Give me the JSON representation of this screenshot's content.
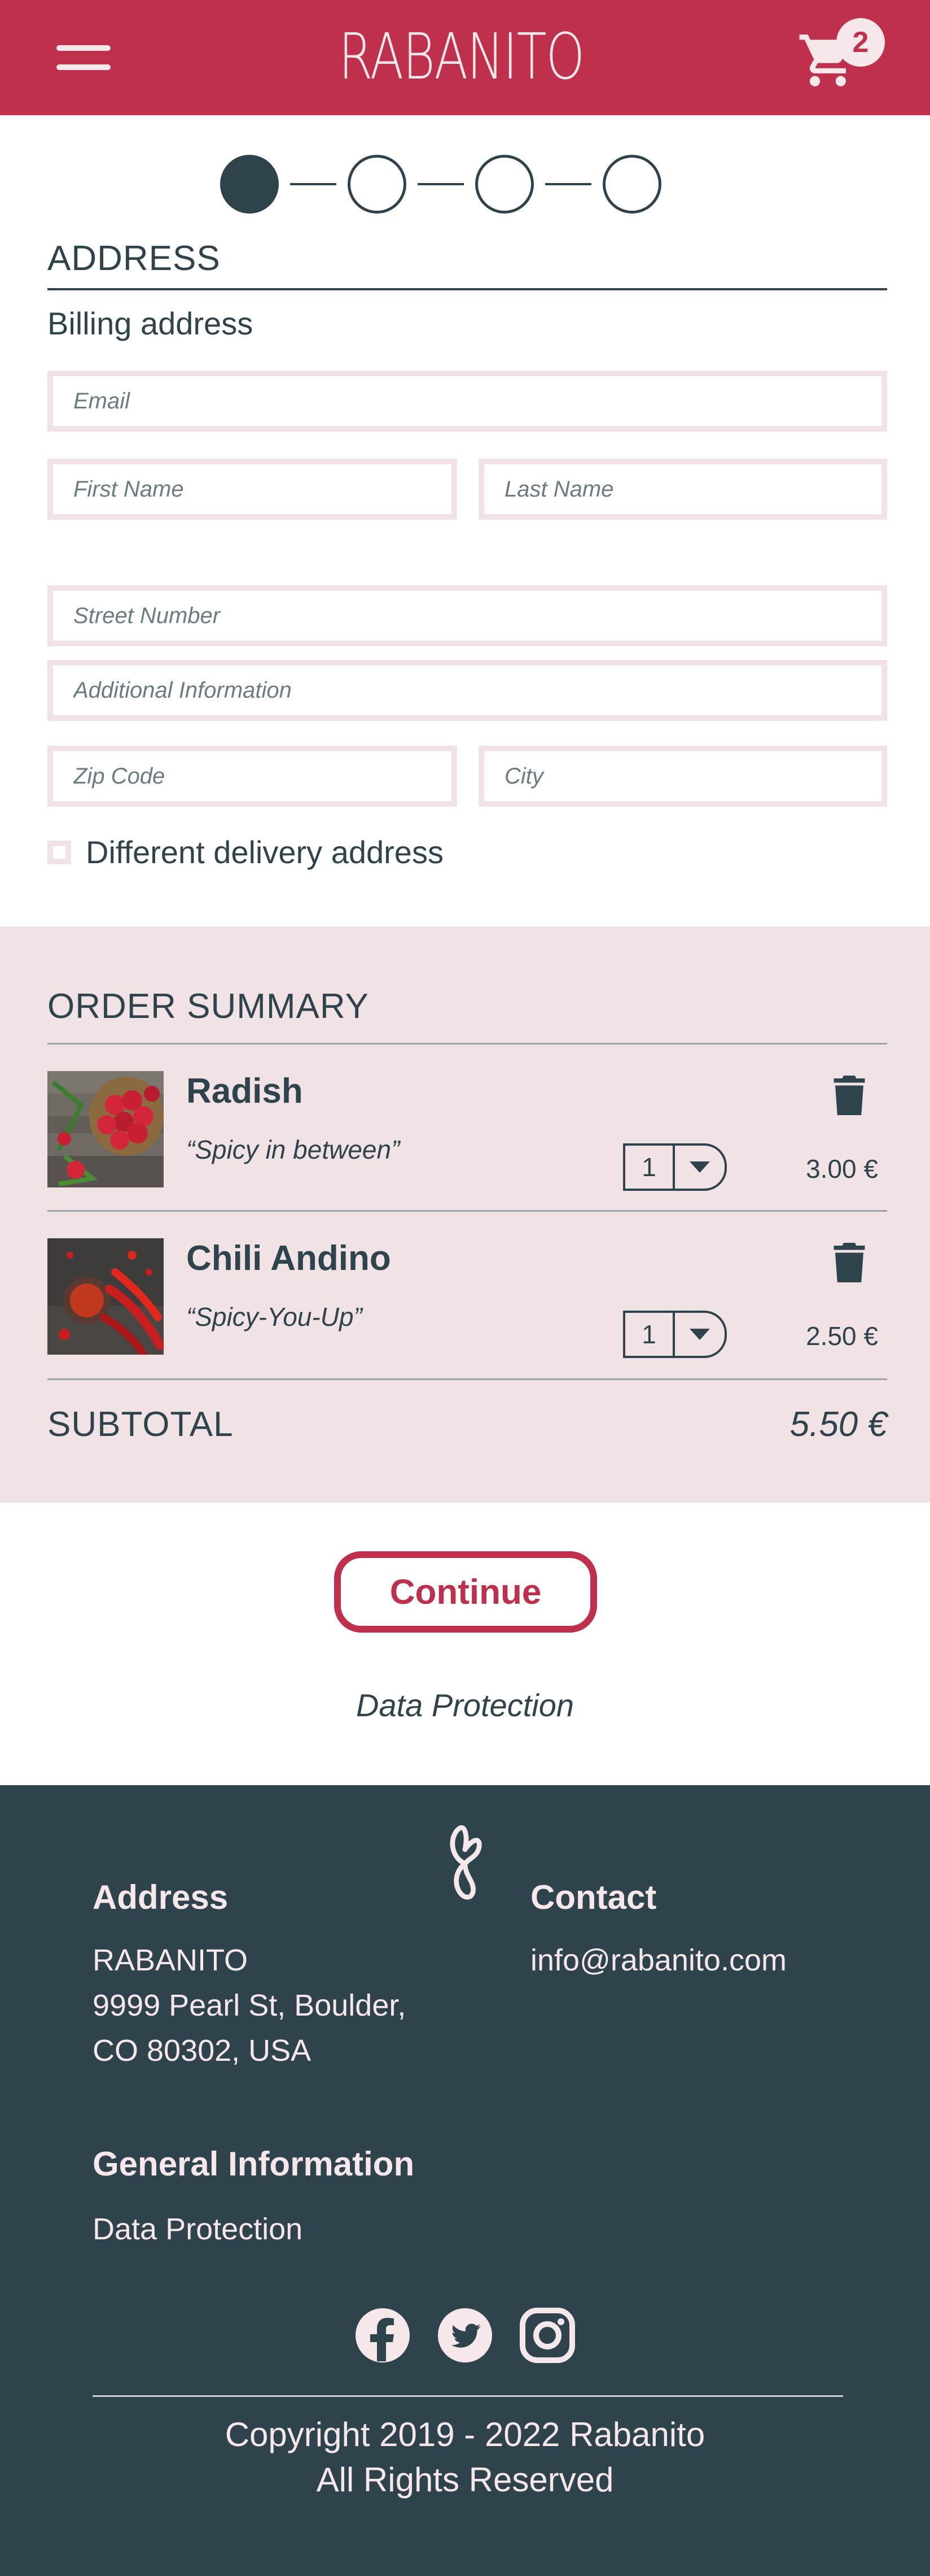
{
  "header": {
    "brand": "RABANITO",
    "cart_count": "2",
    "colors": {
      "primary": "#be304c",
      "dark": "#2f434c",
      "light": "#f1e3e5"
    }
  },
  "steps": {
    "total": 4,
    "current": 1
  },
  "address": {
    "title": "ADDRESS",
    "billing_label": "Billing address",
    "placeholders": {
      "email": "Email",
      "first_name": "First Name",
      "last_name": "Last Name",
      "street": "Street Number",
      "additional": "Additional Information",
      "zip": "Zip Code",
      "city": "City"
    },
    "different_delivery": "Different delivery address"
  },
  "summary": {
    "title": "ORDER SUMMARY",
    "items": [
      {
        "name": "Radish",
        "desc": "“Spicy in between”",
        "qty": "1",
        "price": "3.00 €"
      },
      {
        "name": "Chili Andino",
        "desc": "“Spicy-You-Up”",
        "qty": "1",
        "price": "2.50 €"
      }
    ],
    "subtotal_label": "SUBTOTAL",
    "subtotal_value": "5.50 €"
  },
  "actions": {
    "continue": "Continue",
    "data_protection": "Data Protection"
  },
  "footer": {
    "address_heading": "Address",
    "address_lines": [
      "RABANITO",
      "9999 Pearl St, Boulder,",
      "CO 80302, USA"
    ],
    "contact_heading": "Contact",
    "contact_email": "info@rabanito.com",
    "general_heading": "General Information",
    "general_link": "Data Protection",
    "socials": [
      "facebook-icon",
      "twitter-icon",
      "instagram-icon"
    ],
    "copyright_1": "Copyright 2019 - 2022 Rabanito",
    "copyright_2": "All Rights Reserved"
  }
}
